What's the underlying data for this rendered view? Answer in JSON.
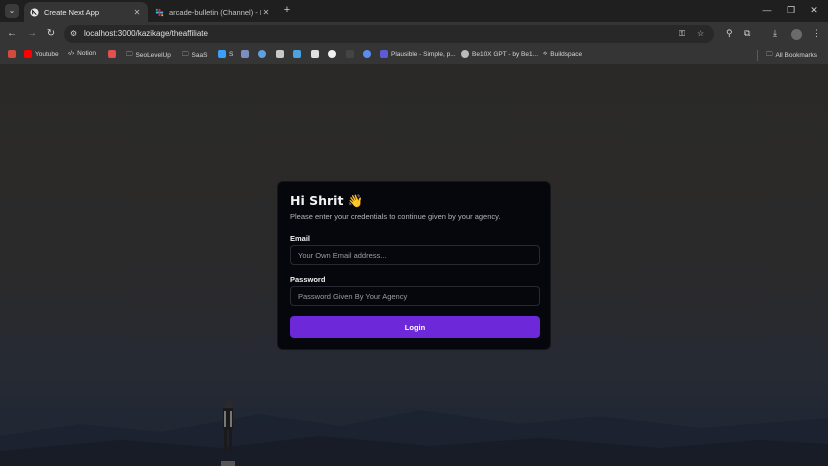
{
  "tabs": [
    {
      "title": "Create Next App",
      "close": "✕"
    },
    {
      "title": "arcade-bulletin (Channel) - Hu",
      "close": "✕"
    }
  ],
  "tabstrip": {
    "new_tab": "+",
    "minimize": "—",
    "restore": "❐",
    "close": "✕",
    "search_tabs": "⌄"
  },
  "toolbar": {
    "back": "←",
    "forward": "→",
    "reload": "↻",
    "url": "localhost:3000/kazikage/theaffiliate"
  },
  "bookmarks": [
    {
      "label": "Youtube",
      "icon": "youtube-icon",
      "color": "#ff0000"
    },
    {
      "label": "Notion",
      "icon": "code-icon",
      "color": "#9a9a9a"
    },
    {
      "label": "",
      "icon": "app-icon",
      "color": "#e05050"
    },
    {
      "label": "SeoLevelUp",
      "icon": "folder-icon",
      "color": "#9a9a9a"
    },
    {
      "label": "SaaS",
      "icon": "folder-icon",
      "color": "#9a9a9a"
    },
    {
      "label": "S",
      "icon": "s-icon",
      "color": "#3aa0ff"
    },
    {
      "label": "Plausible - Simple, p...",
      "icon": "plausible-icon",
      "color": "#5b5bd6"
    },
    {
      "label": "Be10X GPT - by Be1...",
      "icon": "gpt-icon",
      "color": "#bbbbbb"
    },
    {
      "label": "Buildspace",
      "icon": "buildspace-icon",
      "color": "#bbbbbb"
    },
    {
      "label": "All Bookmarks",
      "icon": "folder-icon",
      "color": "#9a9a9a"
    }
  ],
  "login": {
    "greeting": "Hi Shrit 👋",
    "subtitle": "Please enter your credentials to continue given by your agency.",
    "email_label": "Email",
    "email_placeholder": "Your Own Email address...",
    "password_label": "Password",
    "password_placeholder": "Password Given By Your Agency",
    "button": "Login"
  },
  "colors": {
    "accent": "#6d28d9",
    "card_bg": "#05070d"
  }
}
